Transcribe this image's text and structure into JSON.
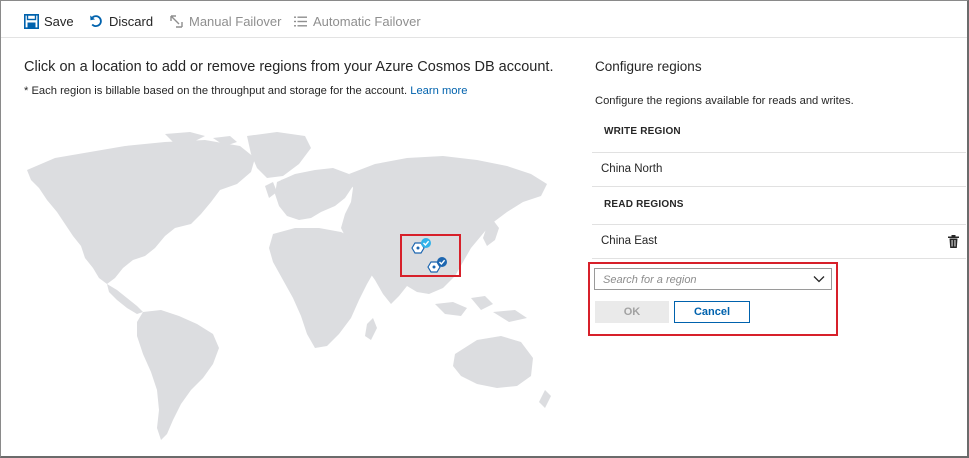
{
  "toolbar": {
    "save": {
      "label": "Save",
      "icon": "save-icon"
    },
    "discard": {
      "label": "Discard",
      "icon": "undo-icon"
    },
    "manual_failover": {
      "label": "Manual Failover",
      "icon": "failover-arrow-icon",
      "enabled": false
    },
    "automatic_failover": {
      "label": "Automatic Failover",
      "icon": "list-icon",
      "enabled": false
    }
  },
  "map_section": {
    "headline": "Click on a location to add or remove regions from your Azure Cosmos DB account.",
    "note": "* Each region is billable based on the throughput and storage for the account.",
    "learn_more": "Learn more"
  },
  "configure": {
    "title": "Configure regions",
    "description": "Configure the regions available for reads and writes.",
    "write_header": "WRITE REGION",
    "write_regions": [
      "China North"
    ],
    "read_header": "READ REGIONS",
    "read_regions": [
      "China East"
    ],
    "search_placeholder": "Search for a region",
    "ok_label": "OK",
    "cancel_label": "Cancel"
  },
  "colors": {
    "accent": "#0062ad",
    "highlight": "#d7202a",
    "map_land": "#dcdde0",
    "pin_checked_light": "#32b2e9",
    "pin_checked_dark": "#1d66b0"
  }
}
